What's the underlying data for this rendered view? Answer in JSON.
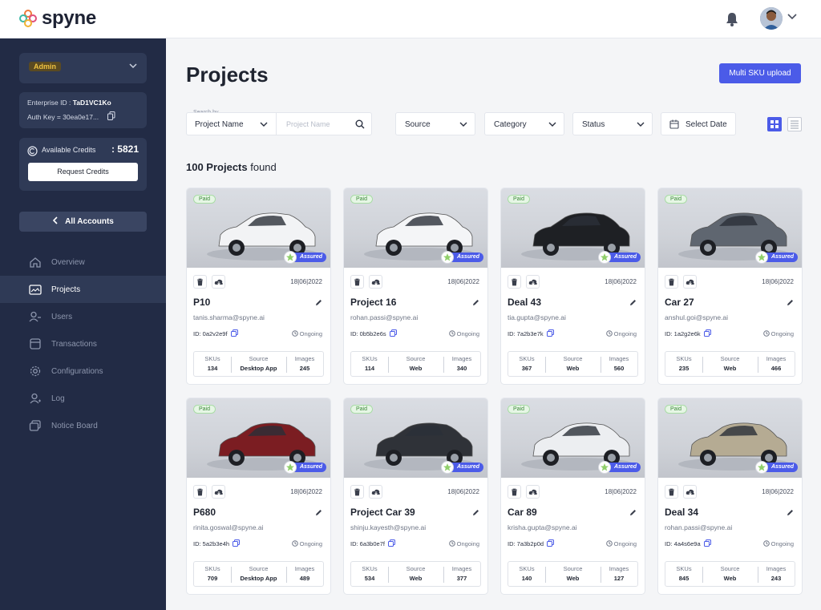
{
  "brand": {
    "name": "spyne"
  },
  "header": {
    "icons": [
      "bell-icon",
      "avatar",
      "chevron-down-icon"
    ]
  },
  "sidebar": {
    "role": "Admin",
    "enterprise_id_label": "Enterprise ID : ",
    "enterprise_id": "TaD1VC1Ko",
    "auth_key": "Auth Key = 30ea0e17...",
    "credits_label": "Available Credits",
    "credits_value": ": 5821",
    "request_credits": "Request Credits",
    "all_accounts": "All Accounts",
    "items": [
      {
        "label": "Overview",
        "icon": "home-icon",
        "active": false
      },
      {
        "label": "Projects",
        "icon": "projects-icon",
        "active": true
      },
      {
        "label": "Users",
        "icon": "users-icon",
        "active": false
      },
      {
        "label": "Transactions",
        "icon": "transactions-icon",
        "active": false
      },
      {
        "label": "Configurations",
        "icon": "gear-icon",
        "active": false
      },
      {
        "label": "Log",
        "icon": "log-icon",
        "active": false
      },
      {
        "label": "Notice Board",
        "icon": "notice-icon",
        "active": false
      }
    ]
  },
  "main": {
    "title": "Projects",
    "multi_sku_upload": "Multi SKU upload",
    "search_by_label": "Search by",
    "search_by_value": "Project Name",
    "search_placeholder": "Project Name",
    "filters": {
      "source": "Source",
      "category": "Category",
      "status": "Status",
      "date": "Select Date"
    },
    "count_number": "100 Projects",
    "count_suffix": " found",
    "cards": [
      {
        "paid": "Paid",
        "assured": "Assured",
        "date": "18|06|2022",
        "name": "P10",
        "email": "tanis.sharma@spyne.ai",
        "id": "ID: 0a2v2e9f",
        "status": "Ongoing",
        "skus": "134",
        "source": "Desktop App",
        "images": "245",
        "car_color": "#f2f3f5"
      },
      {
        "paid": "Paid",
        "assured": "Assured",
        "date": "18|06|2022",
        "name": "Project 16",
        "email": "rohan.passi@spyne.ai",
        "id": "ID: 0b5b2e6s",
        "status": "Ongoing",
        "skus": "114",
        "source": "Web",
        "images": "340",
        "car_color": "#f4f5f7"
      },
      {
        "paid": "Paid",
        "assured": "Assured",
        "date": "18|06|2022",
        "name": "Deal 43",
        "email": "tia.gupta@spyne.ai",
        "id": "ID: 7a2b3e7k",
        "status": "Ongoing",
        "skus": "367",
        "source": "Web",
        "images": "560",
        "car_color": "#1e2024"
      },
      {
        "paid": "Paid",
        "assured": "Assured",
        "date": "18|06|2022",
        "name": "Car 27",
        "email": "anshul.goi@spyne.ai",
        "id": "ID: 1a2g2e6k",
        "status": "Ongoing",
        "skus": "235",
        "source": "Web",
        "images": "466",
        "car_color": "#5f6670"
      },
      {
        "paid": "Paid",
        "assured": "Assured",
        "date": "18|06|2022",
        "name": "P680",
        "email": "rinita.goswal@spyne.ai",
        "id": "ID: 5a2b3e4h",
        "status": "Ongoing",
        "skus": "709",
        "source": "Desktop App",
        "images": "489",
        "car_color": "#7b1d22"
      },
      {
        "paid": "Paid",
        "assured": "Assured",
        "date": "18|06|2022",
        "name": "Project Car 39",
        "email": "shinju.kayesth@spyne.ai",
        "id": "ID: 6a3b0e7f",
        "status": "Ongoing",
        "skus": "534",
        "source": "Web",
        "images": "377",
        "car_color": "#2f3238"
      },
      {
        "paid": "Paid",
        "assured": "Assured",
        "date": "18|06|2022",
        "name": "Car 89",
        "email": "krisha.gupta@spyne.ai",
        "id": "ID: 7a3b2p0d",
        "status": "Ongoing",
        "skus": "140",
        "source": "Web",
        "images": "127",
        "car_color": "#eceef1"
      },
      {
        "paid": "Paid",
        "assured": "Assured",
        "date": "18|06|2022",
        "name": "Deal 34",
        "email": "rohan.passi@spyne.ai",
        "id": "ID: 4a4s6e9a",
        "status": "Ongoing",
        "skus": "845",
        "source": "Web",
        "images": "243",
        "car_color": "#b5ab93"
      }
    ],
    "stat_labels": {
      "skus": "SKUs",
      "source": "Source",
      "images": "Images"
    }
  },
  "colors": {
    "accent": "#4b5be8",
    "sidebar": "#222b45",
    "paid_green": "#3e8a3b"
  }
}
